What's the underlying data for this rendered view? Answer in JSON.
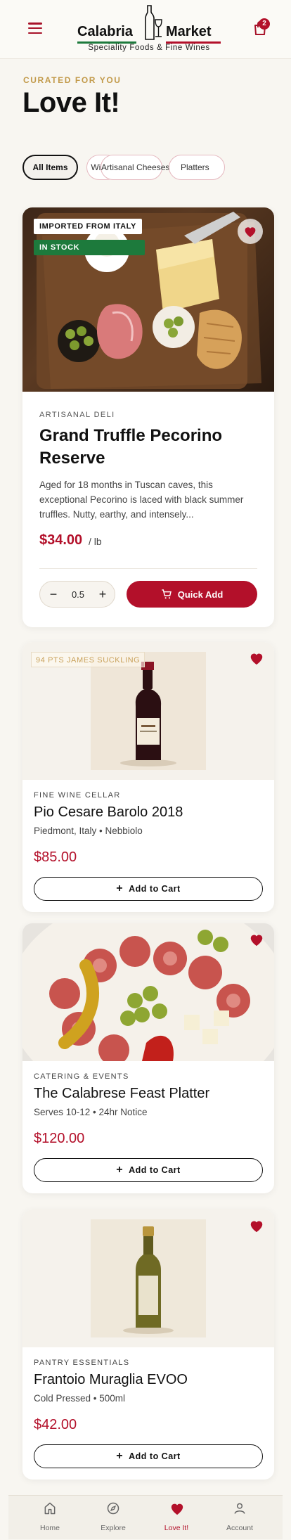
{
  "header": {
    "brand_word1": "Calabria",
    "brand_word2": "Market",
    "brand_tagline": "Speciality Foods & Fine Wines",
    "cart_count": "2",
    "accent": "#b3102a"
  },
  "page": {
    "eyebrow": "CURATED FOR YOU",
    "title": "Love It!"
  },
  "filters": [
    "All Items",
    "Wines",
    "Artisanal Cheeses",
    "Platters"
  ],
  "featured": {
    "badge_origin": "IMPORTED FROM ITALY",
    "badge_stock": "IN STOCK",
    "category": "ARTISANAL DELI",
    "name": "Grand Truffle Pecorino Reserve",
    "description": "Aged for 18 months in Tuscan caves, this exceptional Pecorino is laced with black summer truffles. Nutty, earthy, and intensely...",
    "price": "$34.00",
    "unit": "/ lb",
    "quantity": "0.5",
    "quick_add_label": "Quick Add"
  },
  "products": [
    {
      "badge": "94 PTS JAMES SUCKLING",
      "category": "FINE WINE CELLAR",
      "name": "Pio Cesare Barolo 2018",
      "subtitle": "Piedmont, Italy • Nebbiolo",
      "price": "$85.00",
      "cta": "Add to Cart"
    },
    {
      "category": "CATERING & EVENTS",
      "name": "The Calabrese Feast Platter",
      "subtitle": "Serves 10-12 • 24hr Notice",
      "price": "$120.00",
      "cta": "Add to Cart"
    },
    {
      "category": "PANTRY ESSENTIALS",
      "name": "Frantoio Muraglia EVOO",
      "subtitle": "Cold Pressed • 500ml",
      "price": "$42.00",
      "cta": "Add to Cart"
    }
  ],
  "tabbar": [
    "Home",
    "Explore",
    "Love It!",
    "Account"
  ]
}
